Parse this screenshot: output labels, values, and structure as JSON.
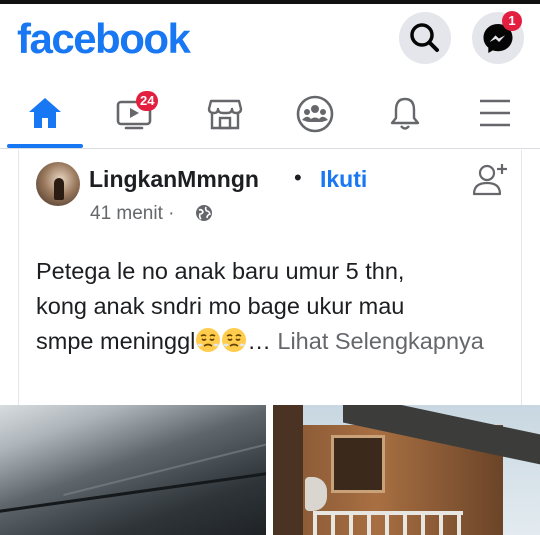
{
  "header": {
    "logo": "facebook",
    "messenger_badge": "1"
  },
  "nav": {
    "video_badge": "24",
    "items": [
      "home-tab",
      "video-tab",
      "marketplace-tab",
      "groups-tab",
      "notifications-tab",
      "menu-tab"
    ]
  },
  "post": {
    "author": "LingkanMmngn",
    "separator": "•",
    "follow_label": "Ikuti",
    "time": "41 menit · ",
    "text_line1": "Petega le no anak baru umur 5 thn,",
    "text_line2": "kong anak sndri mo bage ukur mau",
    "text_line3": "smpe meninggl",
    "ellipsis": "…",
    "see_more": "Lihat Selengkapnya"
  },
  "colors": {
    "brand": "#1877f2",
    "badge": "#e41e3f",
    "secondary_text": "#65676b"
  }
}
